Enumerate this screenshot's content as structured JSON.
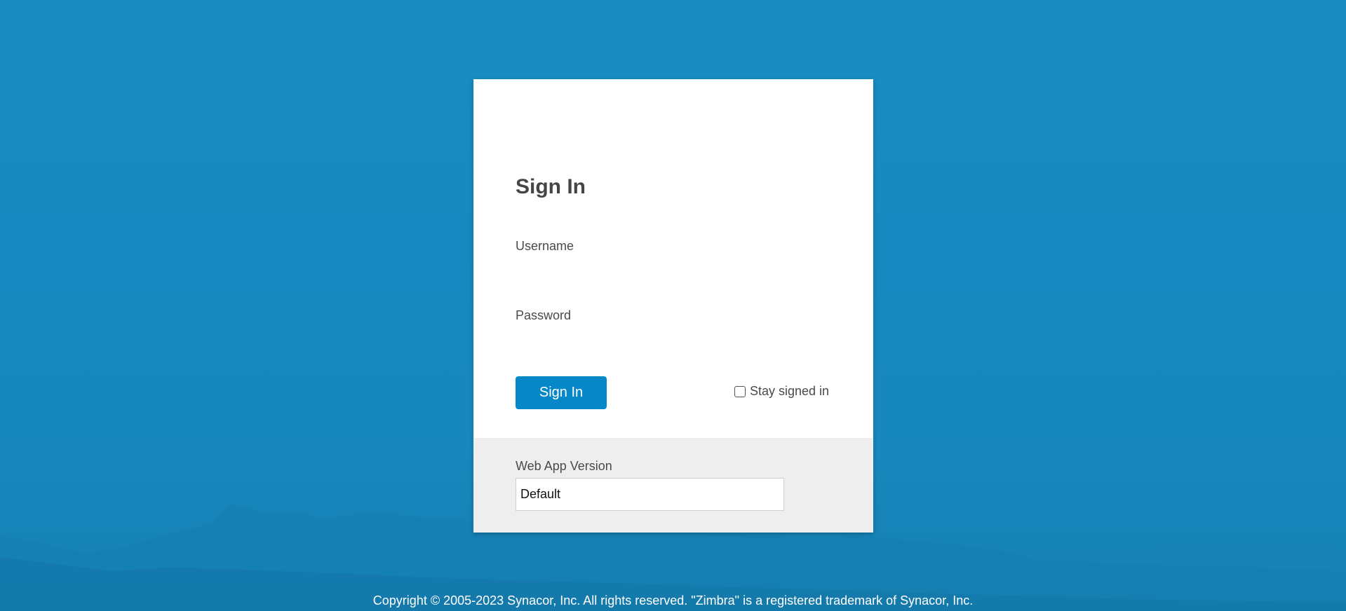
{
  "colors": {
    "background": "#1989bd",
    "accent": "#0587c8",
    "card": "#ffffff",
    "card_footer": "#eeeeee"
  },
  "login": {
    "title": "Sign In",
    "username_label": "Username",
    "username_value": "",
    "password_label": "Password",
    "password_value": "",
    "signin_button": "Sign In",
    "stay_signed_label": "Stay signed in",
    "stay_signed_checked": false
  },
  "version": {
    "label": "Web App Version",
    "selected": "Default"
  },
  "footer": {
    "copyright": "Copyright © 2005-2023 Synacor, Inc. All rights reserved. \"Zimbra\" is a registered trademark of Synacor, Inc."
  }
}
